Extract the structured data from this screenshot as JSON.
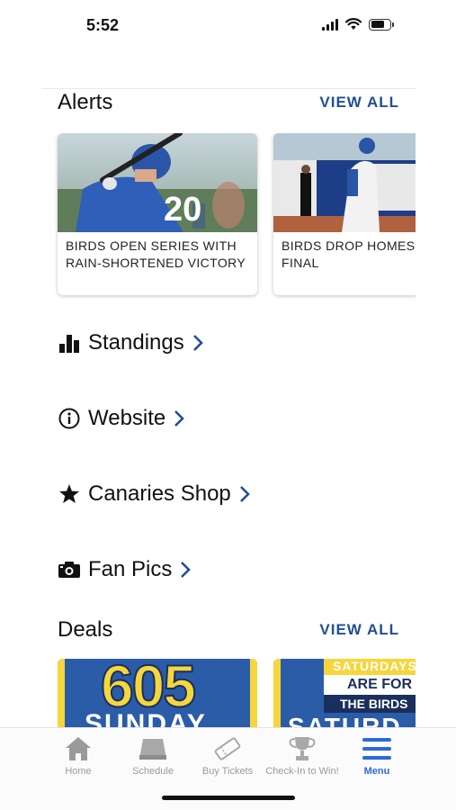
{
  "status_bar": {
    "time": "5:52"
  },
  "alerts": {
    "title": "Alerts",
    "view_all": "VIEW ALL",
    "cards": [
      {
        "headline": "BIRDS OPEN SERIES WITH RAIN-SHORTENED VICTORY",
        "jersey_number": "20"
      },
      {
        "headline": "BIRDS DROP HOMESTAND FINAL"
      }
    ]
  },
  "links": [
    {
      "label": "Standings",
      "icon": "bar-chart-icon"
    },
    {
      "label": "Website",
      "icon": "info-icon"
    },
    {
      "label": "Canaries Shop",
      "icon": "star-icon"
    },
    {
      "label": "Fan Pics",
      "icon": "camera-icon"
    }
  ],
  "deals": {
    "title": "Deals",
    "view_all": "VIEW ALL",
    "cards": [
      {
        "big_text": "605",
        "sub_text": "SUNDAY"
      },
      {
        "line1": "SATURDAYS",
        "line2": "ARE FOR",
        "line3": "THE BIRDS",
        "partial": "SATURD"
      }
    ]
  },
  "tab_bar": {
    "tabs": [
      {
        "label": "Home",
        "icon": "home-icon"
      },
      {
        "label": "Schedule",
        "icon": "schedule-icon"
      },
      {
        "label": "Buy Tickets",
        "icon": "ticket-icon"
      },
      {
        "label": "Check-In to Win!",
        "icon": "trophy-icon"
      },
      {
        "label": "Menu",
        "icon": "menu-icon"
      }
    ],
    "active_tab": "Menu"
  },
  "colors": {
    "accent": "#1f4f96",
    "active_tab": "#2b6ad6",
    "deal_blue": "#2a5ca8",
    "deal_yellow": "#f5d63d"
  }
}
